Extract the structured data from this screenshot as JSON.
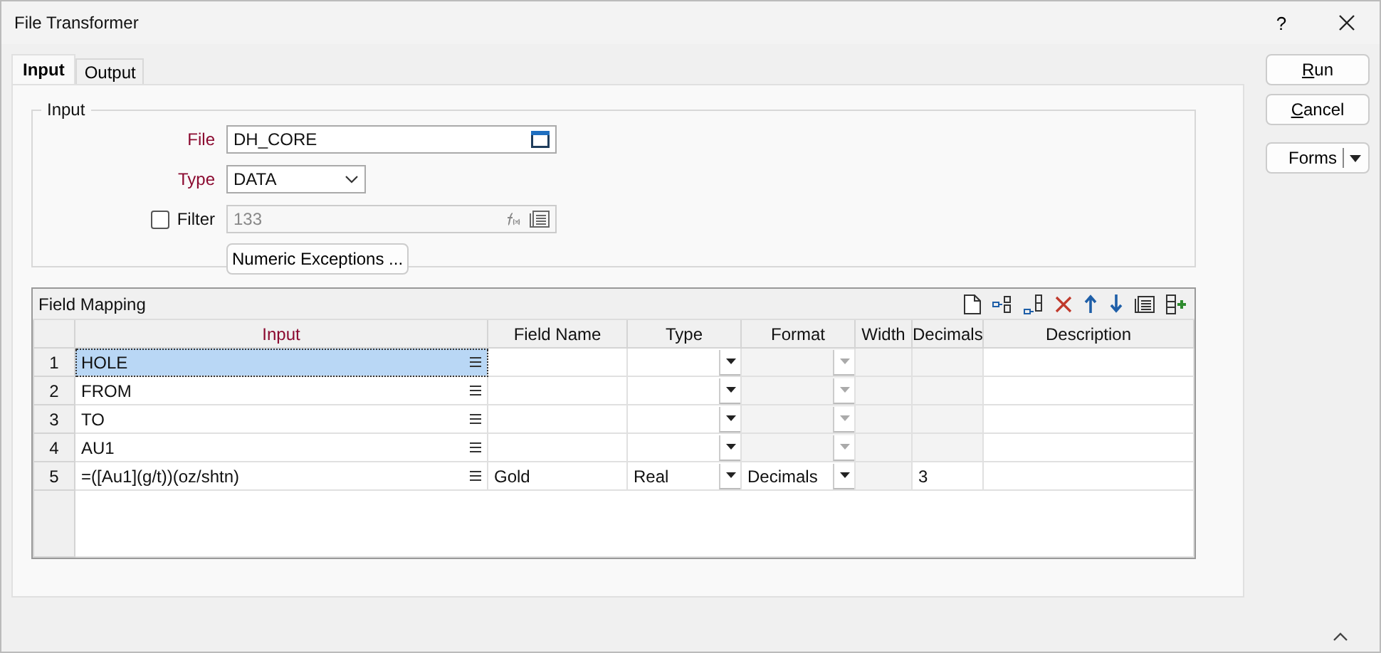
{
  "window": {
    "title": "File Transformer",
    "help": "?"
  },
  "tabs": [
    {
      "label": "Input",
      "selected": true
    },
    {
      "label": "Output",
      "selected": false
    }
  ],
  "input_group": {
    "title": "Input",
    "file": {
      "label": "File",
      "value": "DH_CORE",
      "required": true
    },
    "type": {
      "label": "Type",
      "value": "DATA",
      "required": true
    },
    "filter": {
      "label": "Filter",
      "checked": false,
      "disabled": true,
      "value": "133"
    },
    "numeric_exceptions_button": "Numeric Exceptions ..."
  },
  "field_mapping": {
    "title": "Field Mapping",
    "columns": [
      {
        "label": "Input",
        "required": true
      },
      {
        "label": "Field Name",
        "required": false
      },
      {
        "label": "Type",
        "required": false
      },
      {
        "label": "Format",
        "required": false
      },
      {
        "label": "Width",
        "required": false
      },
      {
        "label": "Decimals",
        "required": false
      },
      {
        "label": "Description",
        "required": false
      }
    ],
    "rows": [
      {
        "number": "1",
        "input": "HOLE",
        "format_disabled": true,
        "selected": true
      },
      {
        "number": "2",
        "input": "FROM",
        "format_disabled": true,
        "selected": false
      },
      {
        "number": "3",
        "input": "TO",
        "format_disabled": true,
        "selected": false
      },
      {
        "number": "4",
        "input": "AU1",
        "format_disabled": true,
        "selected": false
      },
      {
        "number": "5",
        "input": "=([Au1](g/t))(oz/shtn)",
        "field_name": "Gold",
        "type": "Real",
        "format": "Decimals",
        "decimals": "3",
        "format_disabled": false,
        "selected": false
      }
    ]
  },
  "buttons": {
    "run": "Run",
    "cancel": "Cancel",
    "forms": "Forms"
  }
}
